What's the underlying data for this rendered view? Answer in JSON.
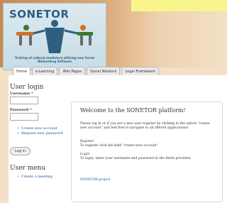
{
  "header": {
    "logo_text": "SONETOR",
    "tagline": "Training of cultural mediators utilizing new Social Networking Software"
  },
  "tabs": [
    {
      "label": "Home"
    },
    {
      "label": "e-Learning"
    },
    {
      "label": "Wiki Pages"
    },
    {
      "label": "Social Network"
    },
    {
      "label": "Legal Framework"
    }
  ],
  "sidebar": {
    "login_title": "User login",
    "username_label": "Username",
    "password_label": "Password",
    "required_mark": "*",
    "links": [
      "Create new account",
      "Request new password"
    ],
    "login_button": "Log in",
    "menu_title": "User menu",
    "menu_items": [
      "Create a meeting"
    ]
  },
  "main": {
    "title": "Welcome to the SONETOR platform!",
    "intro": "Please log in or if you are a new user register by clicking in the option \"create new account\" and feel free to navigate to all offered applications!",
    "register_heading": "Register",
    "register_text": "To register click the field \"create new account\"",
    "login_heading": "Login",
    "login_text": "To login, enter your username and password in the fields provided.",
    "project_link": "SONETOR project"
  },
  "colors": {
    "accent": "#2f5f80",
    "link": "#1a4f9a"
  }
}
